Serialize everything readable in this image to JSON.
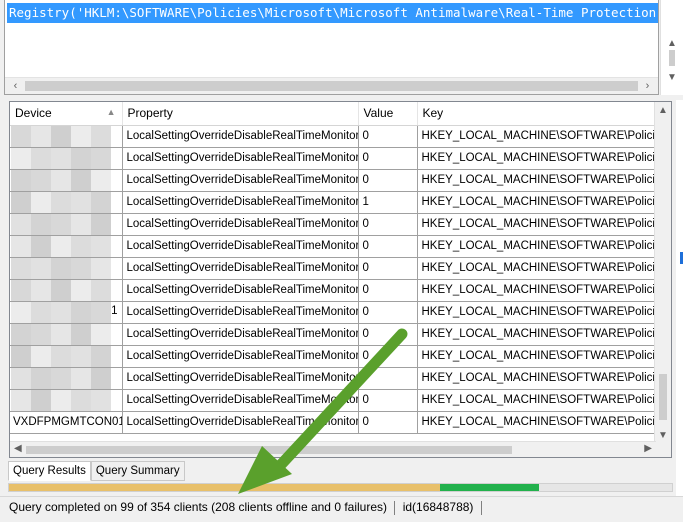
{
  "editor": {
    "query_text": "Registry('HKLM:\\SOFTWARE\\Policies\\Microsoft\\Microsoft Antimalware\\Real-Time Protection"
  },
  "grid": {
    "columns": [
      "Device",
      "Property",
      "Value",
      "Key"
    ],
    "rows": [
      {
        "device": "",
        "property": "LocalSettingOverrideDisableRealTimeMonitoring",
        "value": "0",
        "key": "HKEY_LOCAL_MACHINE\\SOFTWARE\\Policies\\"
      },
      {
        "device": "",
        "property": "LocalSettingOverrideDisableRealTimeMonitoring",
        "value": "0",
        "key": "HKEY_LOCAL_MACHINE\\SOFTWARE\\Policies\\"
      },
      {
        "device": "",
        "property": "LocalSettingOverrideDisableRealTimeMonitoring",
        "value": "0",
        "key": "HKEY_LOCAL_MACHINE\\SOFTWARE\\Policies\\"
      },
      {
        "device": "",
        "property": "LocalSettingOverrideDisableRealTimeMonitoring",
        "value": "1",
        "key": "HKEY_LOCAL_MACHINE\\SOFTWARE\\Policies\\"
      },
      {
        "device": "",
        "property": "LocalSettingOverrideDisableRealTimeMonitoring",
        "value": "0",
        "key": "HKEY_LOCAL_MACHINE\\SOFTWARE\\Policies\\"
      },
      {
        "device": "",
        "property": "LocalSettingOverrideDisableRealTimeMonitoring",
        "value": "0",
        "key": "HKEY_LOCAL_MACHINE\\SOFTWARE\\Policies\\"
      },
      {
        "device": "",
        "property": "LocalSettingOverrideDisableRealTimeMonitoring",
        "value": "0",
        "key": "HKEY_LOCAL_MACHINE\\SOFTWARE\\Policies\\"
      },
      {
        "device": "",
        "property": "LocalSettingOverrideDisableRealTimeMonitoring",
        "value": "0",
        "key": "HKEY_LOCAL_MACHINE\\SOFTWARE\\Policies\\"
      },
      {
        "device": "1",
        "property": "LocalSettingOverrideDisableRealTimeMonitoring",
        "value": "0",
        "key": "HKEY_LOCAL_MACHINE\\SOFTWARE\\Policies\\"
      },
      {
        "device": "",
        "property": "LocalSettingOverrideDisableRealTimeMonitoring",
        "value": "0",
        "key": "HKEY_LOCAL_MACHINE\\SOFTWARE\\Policies\\"
      },
      {
        "device": "",
        "property": "LocalSettingOverrideDisableRealTimeMonitoring",
        "value": "0",
        "key": "HKEY_LOCAL_MACHINE\\SOFTWARE\\Policies\\"
      },
      {
        "device": "",
        "property": "LocalSettingOverrideDisableRealTimeMonitoring",
        "value": "",
        "key": "HKEY_LOCAL_MACHINE\\SOFTWARE\\Policies\\"
      },
      {
        "device": "",
        "property": "LocalSettingOverrideDisableRealTimeMonitoring",
        "value": "0",
        "key": "HKEY_LOCAL_MACHINE\\SOFTWARE\\Policies\\"
      },
      {
        "device": "VXDFPMGMTCON01",
        "property": "LocalSettingOverrideDisableRealTimeMonitoring",
        "value": "0",
        "key": "HKEY_LOCAL_MACHINE\\SOFTWARE\\Policies\\"
      }
    ]
  },
  "tabs": [
    {
      "label": "Query Results",
      "active": true
    },
    {
      "label": "Query Summary",
      "active": false
    }
  ],
  "progress": {
    "completed_fraction": 0.8,
    "success_fraction": 0.15,
    "colors": {
      "offline": "#e8c06a",
      "success": "#22b14c",
      "remaining": "#e6e6e6"
    }
  },
  "status": {
    "message": "Query completed on 99 of 354 clients (208 clients offline and 0 failures)",
    "id": "id(16848788)"
  },
  "colors": {
    "selection": "#3399ff",
    "annotation_arrow": "#5aa02c"
  }
}
